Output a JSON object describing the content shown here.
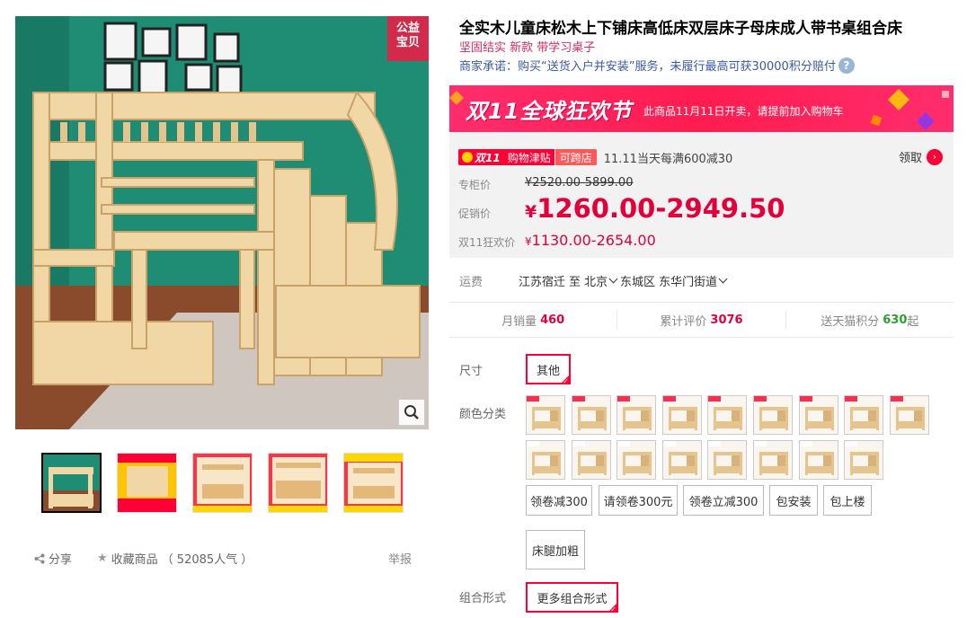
{
  "gallery": {
    "charity_badge": [
      "公益",
      "宝贝"
    ],
    "zoom_icon": "magnifier-icon",
    "thumbnails": [
      {
        "caption": ""
      },
      {
        "caption": "300元"
      },
      {
        "caption": ""
      },
      {
        "caption": ""
      },
      {
        "caption": "300"
      }
    ]
  },
  "actions": {
    "share_label": "分享",
    "favorite_label": "收藏商品",
    "favorite_count": "（ 52085人气 ）",
    "report_label": "举报"
  },
  "product": {
    "title": "全实木儿童床松木上下铺床高低床双层床子母床成人带书桌组合床",
    "subtitle": "坚固结实 新款 带学习桌子",
    "promise": "商家承诺：购买“送货入户并安装”服务，未履行最高可获30000积分赔付",
    "help_icon": "?"
  },
  "promo": {
    "banner_title": "双11全球狂欢节",
    "banner_note": "此商品11月11日开卖，请提前加入购物车",
    "subsidy_logo": "双11",
    "subsidy_text": "购物津贴",
    "subsidy_cross": "可跨店",
    "subsidy_desc": "11.11当天每满600减30",
    "claim_label": "领取",
    "claim_icon": "›"
  },
  "prices": {
    "original_label": "专柜价",
    "original_value": "¥2520.00-5899.00",
    "promo_label": "促销价",
    "promo_yen": "¥",
    "promo_value": "1260.00-2949.50",
    "sale_label": "双11狂欢价",
    "sale_yen": "¥",
    "sale_value": "1130.00-2654.00"
  },
  "shipping": {
    "label": "运费",
    "from": "江苏宿迁",
    "to_word": "至",
    "city": "北京",
    "district": "东城区",
    "street": "东华门街道"
  },
  "stats": {
    "monthly_label": "月销量",
    "monthly_value": "460",
    "reviews_label": "累计评价",
    "reviews_value": "3076",
    "points_label": "送天猫积分",
    "points_value": "630",
    "points_suffix": "起"
  },
  "options": {
    "size_label": "尺寸",
    "size_selected": "其他",
    "color_label": "颜色分类",
    "text_options": [
      "领卷减300",
      "请领卷300元",
      "领卷立减300",
      "包安装",
      "包上楼",
      "床腿加粗"
    ],
    "combo_label": "组合形式",
    "combo_selected": "更多组合形式"
  },
  "colors": {
    "accent": "#ff0036",
    "price": "#e3003a",
    "link": "#3a5aa3",
    "subtitle": "#d42c5f"
  }
}
